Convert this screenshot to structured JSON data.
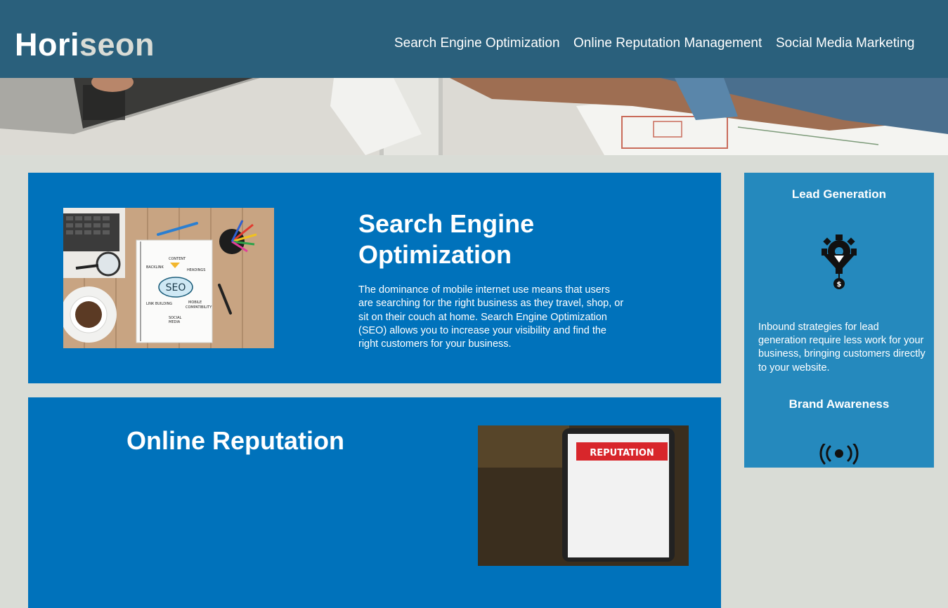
{
  "header": {
    "logo_part1": "Hori",
    "logo_part2": "seon",
    "nav": [
      "Search Engine Optimization",
      "Online Reputation Management",
      "Social Media Marketing"
    ]
  },
  "main": {
    "seo": {
      "title": "Search Engine Optimization",
      "text": "The dominance of mobile internet use means that users are searching for the right business as they travel, shop, or sit on their couch at home. Search Engine Optimization (SEO) allows you to increase your visibility and find the right customers for your business.",
      "image_labels": {
        "center": "SEO",
        "content": "CONTENT",
        "backlink": "BACKLINK",
        "headings": "HEADINGS",
        "link_building": "LINK BUILDING",
        "mobile": "MOBILE",
        "compatibility": "COMPATIBILITY",
        "social": "SOCIAL",
        "media": "MEDIA"
      }
    },
    "orm": {
      "title": "Online Reputation",
      "image_label": "REPUTATION"
    }
  },
  "sidebar": {
    "lead": {
      "title": "Lead Generation",
      "text": "Inbound strategies for lead generation require less work for your business, bringing customers directly to your website."
    },
    "brand": {
      "title": "Brand Awareness"
    }
  },
  "colors": {
    "header_bg": "#2a607c",
    "logo_accent": "#d9dcd6",
    "page_bg": "#d9dcd6",
    "card_bg": "#0072bb",
    "sidebar_bg": "#2589bd"
  },
  "icons": {
    "lead": "lead-generation-funnel-icon",
    "brand": "brand-awareness-broadcast-icon"
  }
}
